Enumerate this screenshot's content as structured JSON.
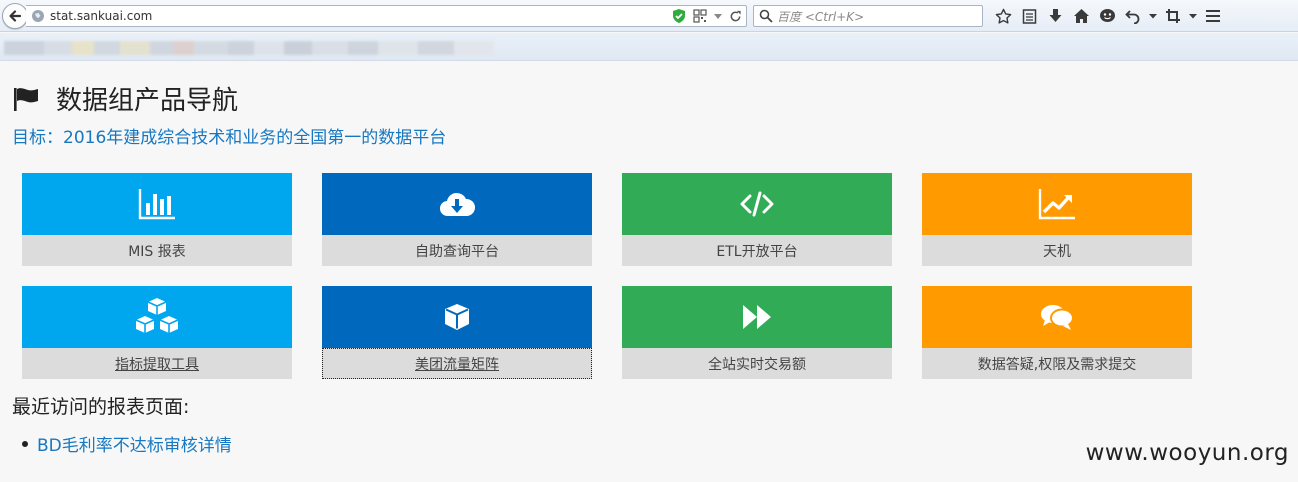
{
  "browser": {
    "url": "stat.sankuai.com",
    "search_placeholder": "百度 <Ctrl+K>"
  },
  "page": {
    "title": "数据组产品导航",
    "goal": "目标：2016年建成综合技术和业务的全国第一的数据平台",
    "tiles": [
      {
        "label": "MIS 报表",
        "icon": "bar-chart-icon",
        "color": "#00a6ee"
      },
      {
        "label": "自助查询平台",
        "icon": "cloud-download-icon",
        "color": "#0069be"
      },
      {
        "label": "ETL开放平台",
        "icon": "code-icon",
        "color": "#32ab56"
      },
      {
        "label": "天机",
        "icon": "line-chart-icon",
        "color": "#ff9a00"
      },
      {
        "label": "指标提取工具",
        "icon": "cubes-icon",
        "color": "#00a6ee"
      },
      {
        "label": "美团流量矩阵",
        "icon": "cube-icon",
        "color": "#0069be"
      },
      {
        "label": "全站实时交易额",
        "icon": "fast-forward-icon",
        "color": "#32ab56"
      },
      {
        "label": "数据答疑,权限及需求提交",
        "icon": "comments-icon",
        "color": "#ff9a00"
      }
    ],
    "recent_title": "最近访问的报表页面:",
    "recent_links": [
      "BD毛利率不达标审核详情"
    ]
  },
  "watermark": "www.wooyun.org"
}
